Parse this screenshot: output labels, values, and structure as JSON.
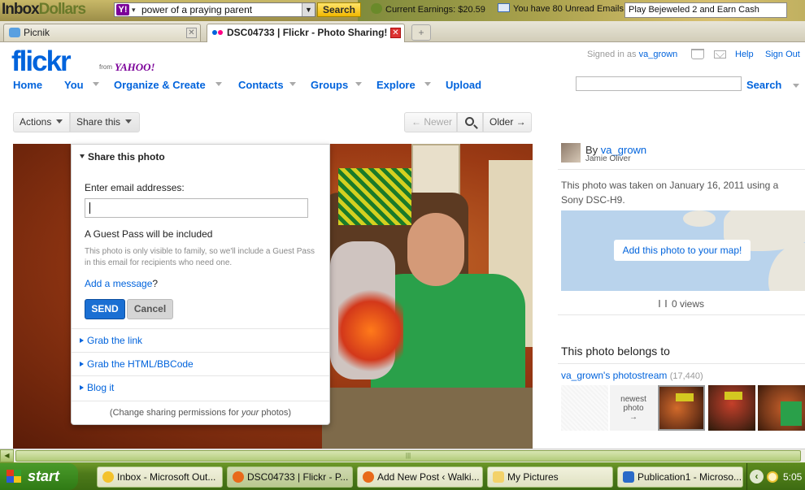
{
  "toolbar": {
    "logo_a": "Inbox",
    "logo_b": "Dollars",
    "search_value": "power of a praying parent",
    "search_button": "Search",
    "earnings": "Current Earnings: $20.59",
    "mail": "You have 80 Unread Emails",
    "promo": "Play Bejeweled 2 and Earn Cash"
  },
  "tabs": [
    {
      "label": "Picnik"
    },
    {
      "label": "DSC04733 | Flickr - Photo Sharing!"
    }
  ],
  "header": {
    "logo_a": "flickr",
    "logo_b": "",
    "from": "from",
    "yahoo": "YAHOO!",
    "signed_in": "Signed in as",
    "username": "va_grown",
    "help": "Help",
    "sign_out": "Sign Out",
    "search": "Search"
  },
  "nav": [
    "Home",
    "You",
    "Organize & Create",
    "Contacts",
    "Groups",
    "Explore",
    "Upload"
  ],
  "actions": {
    "actions": "Actions",
    "share": "Share this",
    "newer": "← Newer",
    "older": "Older →"
  },
  "share": {
    "header": "Share this photo",
    "email_label": "Enter email addresses:",
    "email_value": "",
    "guest_pass": "A Guest Pass will be included",
    "guest_note": "This photo is only visible to family, so we'll include a Guest Pass in this email for recipients who need one.",
    "add_message": "Add a message",
    "add_message_q": "?",
    "send": "SEND",
    "cancel": "Cancel",
    "grab_link": "Grab the link",
    "grab_html": "Grab the HTML/BBCode",
    "blog_it": "Blog it",
    "perm_a": "(Change sharing permissions for ",
    "perm_b": "your",
    "perm_c": " photos)"
  },
  "sidebar": {
    "by": "By",
    "owner": "va_grown",
    "real_name": "Jamie Oliver",
    "taken": "This photo was taken on January 16, 2011 using a Sony DSC-H9.",
    "map_button": "Add this photo to your map!",
    "views": "0 views",
    "belongs": "This photo belongs to",
    "stream": "va_grown's photostream",
    "stream_count": "(17,440)",
    "newest_a": "newest",
    "newest_b": "photo",
    "newest_arrow": "→"
  },
  "taskbar": {
    "start": "start",
    "items": [
      {
        "label": "Inbox - Microsoft Out..."
      },
      {
        "label": "DSC04733 | Flickr - P..."
      },
      {
        "label": "Add New Post ‹ Walki..."
      },
      {
        "label": "My Pictures"
      },
      {
        "label": "Publication1 - Microso..."
      }
    ],
    "clock": "5:05"
  },
  "colors": {
    "flickr_blue": "#0063dc",
    "flickr_pink": "#ff0084",
    "yahoo_purple": "#7b0099",
    "send_blue": "#1a6fd3",
    "xp_green": "#3d6b12"
  },
  "icons": [
    "yahoo-icon",
    "earnings-icon",
    "mail-icon",
    "cart-icon",
    "envelope-icon",
    "zoom-icon",
    "views-icon",
    "windows-flag-icon"
  ]
}
